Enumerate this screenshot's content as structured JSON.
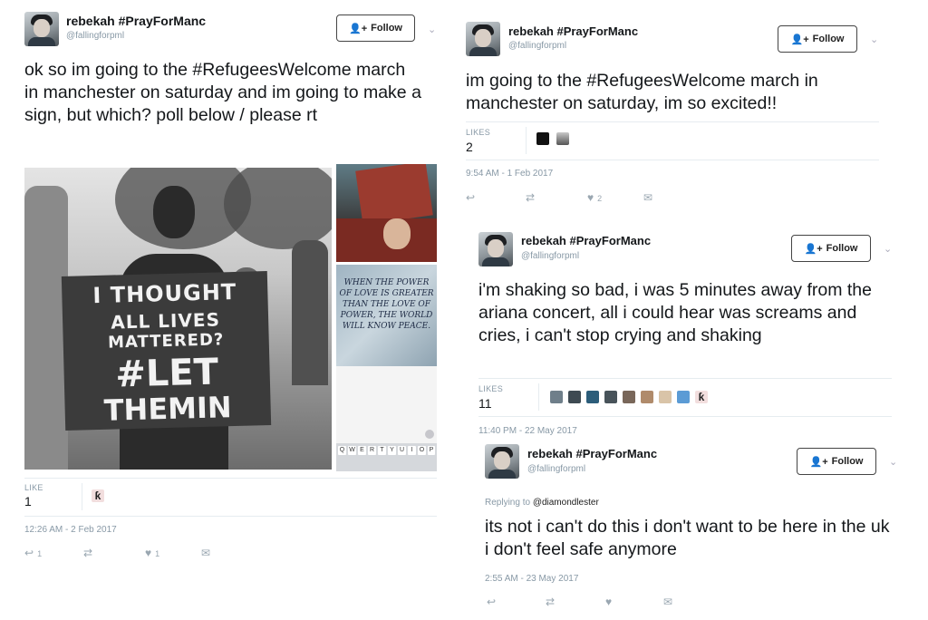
{
  "tweets": [
    {
      "author": "rebekah #PrayForManc",
      "handle": "@fallingforpml",
      "follow_label": "Follow",
      "text": "ok so im going to the #RefugeesWelcome march in manchester on saturday and im going to make a sign, but which? poll below / please rt",
      "likes_label": "LIKE",
      "likes_count": "1",
      "timestamp": "12:26 AM - 2 Feb 2017",
      "reply_count": "1",
      "heart_count": "1",
      "photo": {
        "sign_lines": [
          "I THOUGHT",
          "ALL LIVES",
          "MATTERED?",
          "#LET",
          "THEMIN"
        ],
        "graffiti": "WHEN THE POWER OF LOVE IS GREATER THAN THE LOVE OF POWER, THE WORLD WILL KNOW PEACE.",
        "keyboard": [
          "Q",
          "W",
          "E",
          "R",
          "T",
          "Y",
          "U",
          "I",
          "O",
          "P"
        ]
      }
    },
    {
      "author": "rebekah #PrayForManc",
      "handle": "@fallingforpml",
      "follow_label": "Follow",
      "text": "im going to the #RefugeesWelcome march in manchester on saturday, im so excited!!",
      "likes_label": "LIKES",
      "likes_count": "2",
      "timestamp": "9:54 AM - 1 Feb 2017",
      "heart_count": "2"
    },
    {
      "author": "rebekah #PrayForManc",
      "handle": "@fallingforpml",
      "follow_label": "Follow",
      "text": "i'm shaking so bad, i was 5 minutes away from the ariana concert, all i could hear was screams and cries, i can't stop crying and shaking",
      "likes_label": "LIKES",
      "likes_count": "11",
      "timestamp": "11:40 PM - 22 May 2017"
    },
    {
      "author": "rebekah #PrayForManc",
      "handle": "@fallingforpml",
      "follow_label": "Follow",
      "replying_prefix": "Replying to",
      "replying_to": "@diamondlester",
      "text": "its not i can't do this i don't want to be here in the uk i don't feel safe anymore",
      "timestamp": "2:55 AM - 23 May 2017"
    }
  ],
  "icons": {
    "follow": "person-plus-icon",
    "chevron": "chevron-down-icon",
    "reply": "reply-icon",
    "retweet": "retweet-icon",
    "like": "heart-icon",
    "dm": "envelope-icon"
  },
  "colors": {
    "meta": "#8899a6",
    "divider": "#e6ecf0",
    "text": "#14171a"
  }
}
